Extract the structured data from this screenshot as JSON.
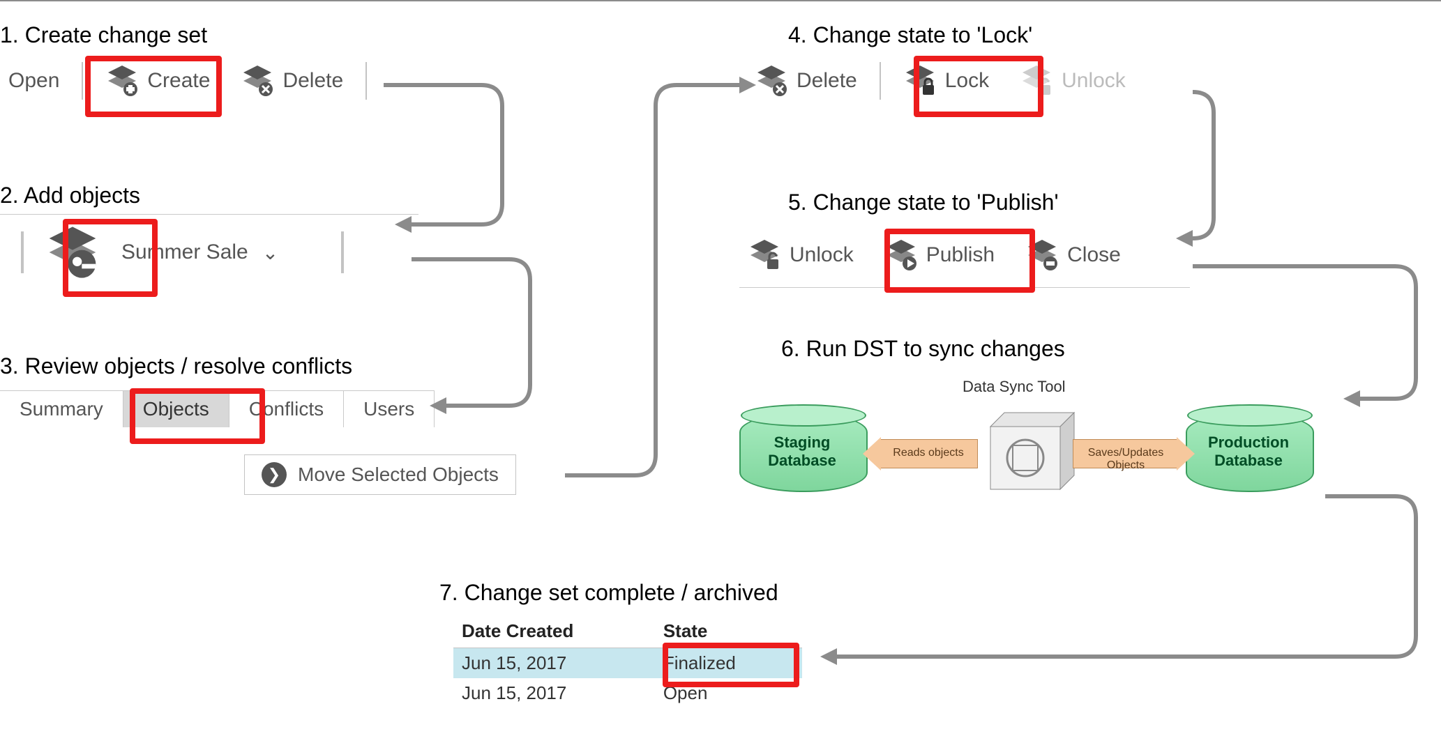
{
  "steps": {
    "s1": {
      "title": "1. Create change set"
    },
    "s2": {
      "title": "2. Add objects"
    },
    "s3": {
      "title": "3. Review objects / resolve conflicts"
    },
    "s4": {
      "title": "4. Change state to 'Lock'"
    },
    "s5": {
      "title": "5. Change state to 'Publish'"
    },
    "s6": {
      "title": "6. Run DST to sync changes"
    },
    "s7": {
      "title": "7. Change set complete / archived"
    }
  },
  "toolbar1": {
    "open": "Open",
    "create": "Create",
    "delete": "Delete"
  },
  "addObjects": {
    "selected": "Summer Sale"
  },
  "tabs": {
    "summary": "Summary",
    "objects": "Objects",
    "conflicts": "Conflicts",
    "users": "Users"
  },
  "moveBtn": "Move Selected Objects",
  "toolbar4": {
    "delete": "Delete",
    "lock": "Lock",
    "unlock": "Unlock"
  },
  "toolbar5": {
    "unlock": "Unlock",
    "publish": "Publish",
    "close": "Close"
  },
  "dst": {
    "title": "Data Sync Tool",
    "staging": "Staging\nDatabase",
    "production": "Production\nDatabase",
    "reads": "Reads objects",
    "saves": "Saves/Updates Objects"
  },
  "table7": {
    "headers": {
      "date": "Date Created",
      "state": "State"
    },
    "rows": [
      {
        "date": "Jun 15, 2017",
        "state": "Finalized"
      },
      {
        "date": "Jun 15, 2017",
        "state": "Open"
      }
    ]
  }
}
